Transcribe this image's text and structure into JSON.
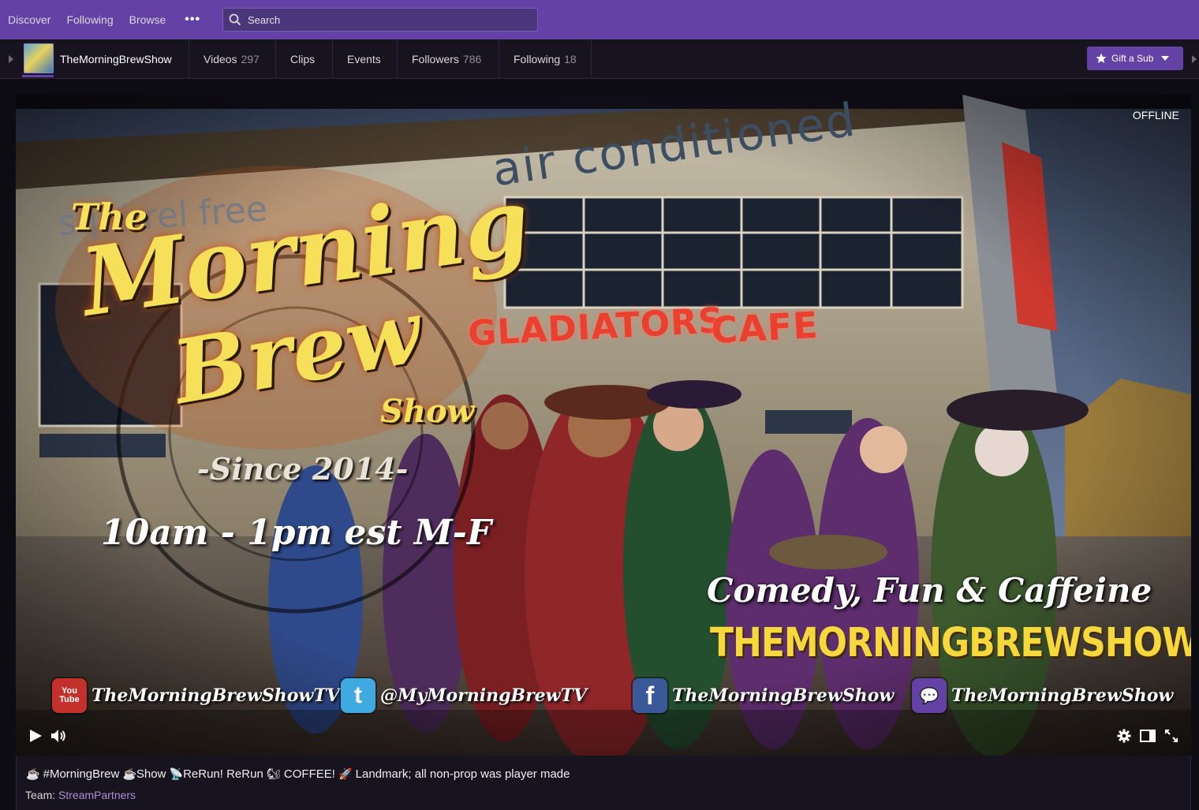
{
  "nav": {
    "links": [
      "Discover",
      "Following",
      "Browse"
    ],
    "more": "•••",
    "search_placeholder": "Search"
  },
  "channel": {
    "name": "TheMorningBrewShow",
    "tabs": [
      {
        "label": "Videos",
        "count": "297"
      },
      {
        "label": "Clips",
        "count": ""
      },
      {
        "label": "Events",
        "count": ""
      },
      {
        "label": "Followers",
        "count": "786"
      },
      {
        "label": "Following",
        "count": "18"
      }
    ],
    "gift_label": "Gift a Sub"
  },
  "player": {
    "status": "OFFLINE",
    "banner": {
      "title_the": "The",
      "title_morning": "Morning",
      "title_brew": "Brew",
      "title_show": "Show",
      "since": "-Since 2014-",
      "hours": "10am - 1pm est M-F",
      "tagline": "Comedy, Fun & Caffeine",
      "url": "THEMORNINGBREWSHOW.TV",
      "sign_air": "air conditioned",
      "sign_squirrel": "squirrel free",
      "sign_gladiators": "GLADIATORS",
      "sign_cafe": "CAFE",
      "socials": [
        {
          "icon": "youtube-icon",
          "icon_text": "You Tube",
          "color": "#c4302b",
          "label": "TheMorningBrewShowTV"
        },
        {
          "icon": "twitter-icon",
          "icon_text": "t",
          "color": "#3fa9e0",
          "label": "@MyMorningBrewTV"
        },
        {
          "icon": "facebook-icon",
          "icon_text": "f",
          "color": "#3b5998",
          "label": "TheMorningBrewShow"
        },
        {
          "icon": "twitch-icon",
          "icon_text": "💬",
          "color": "#6441a4",
          "label": "TheMorningBrewShow"
        }
      ]
    }
  },
  "info": {
    "title_parts": [
      {
        "emoji": "☕",
        "text": " #MorningBrew "
      },
      {
        "emoji": "☕",
        "text": "Show "
      },
      {
        "emoji": "📡",
        "text": "ReRun! ReRun "
      },
      {
        "emoji": "🐿",
        "text": " COFFEE! "
      },
      {
        "emoji": "🚀",
        "text": " Landmark; all non-prop was player made"
      }
    ],
    "team_label": "Team:",
    "team_name": "StreamPartners"
  },
  "colors": {
    "brand": "#6441a4",
    "accent_yellow": "#f6e05a",
    "sign_red": "#e9402f"
  }
}
